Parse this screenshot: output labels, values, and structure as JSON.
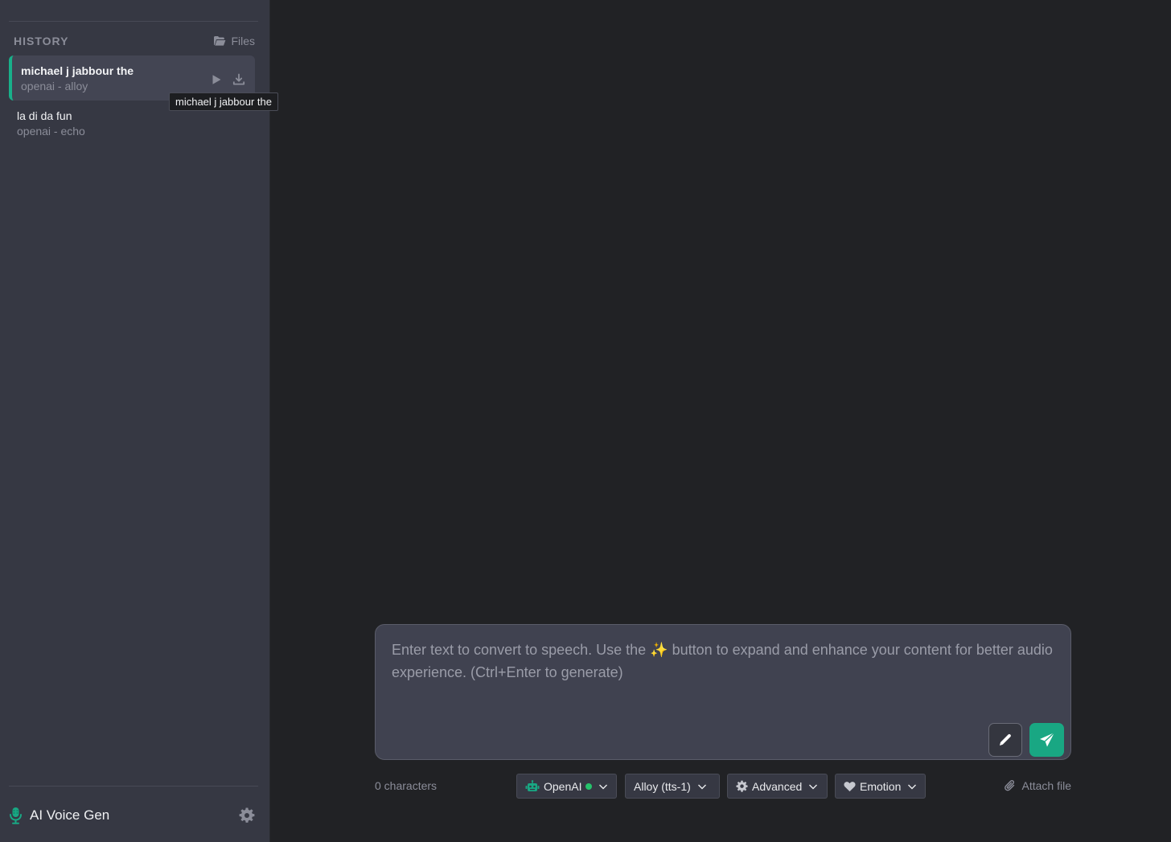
{
  "sidebar": {
    "history_title": "HISTORY",
    "files_label": "Files",
    "items": [
      {
        "title": "michael j jabbour the",
        "subtitle": "openai - alloy",
        "active": true
      },
      {
        "title": "la di da fun",
        "subtitle": "openai - echo",
        "active": false
      }
    ],
    "tooltip": "michael j jabbour the",
    "brand_name": "AI Voice Gen"
  },
  "composer": {
    "placeholder": "Enter text to convert to speech. Use the ✨ button to expand and enhance your content for better audio experience. (Ctrl+Enter to generate)",
    "value": ""
  },
  "toolbar": {
    "char_count": "0 characters",
    "provider_label": "OpenAI",
    "voice_label": "Alloy (tts-1)",
    "advanced_label": "Advanced",
    "emotion_label": "Emotion",
    "attach_label": "Attach file"
  },
  "colors": {
    "accent": "#19a783",
    "status_online": "#25c26b",
    "sidebar_bg": "#363843",
    "main_bg": "#212225"
  },
  "icons": {
    "files": "folder-open-icon",
    "play": "play-icon",
    "download": "download-icon",
    "brand": "microphone-icon",
    "settings": "gear-icon",
    "enhance": "pencil-icon",
    "send": "send-icon",
    "provider": "robot-icon",
    "advanced": "gear-icon",
    "emotion": "heart-icon",
    "attach": "paperclip-icon",
    "dropdown": "chevron-down-icon"
  }
}
